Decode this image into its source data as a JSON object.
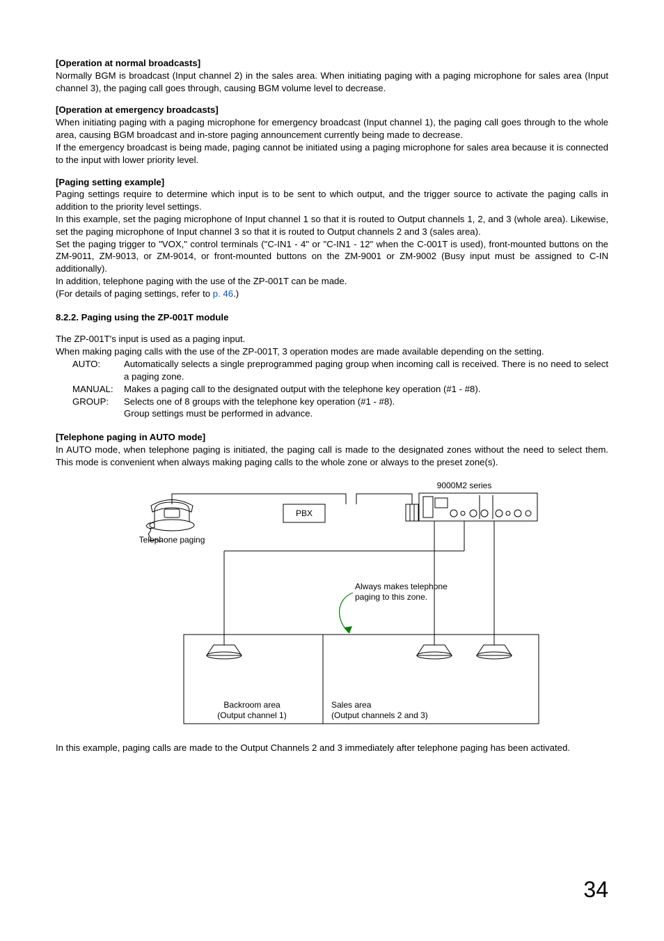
{
  "s1": {
    "heading": "[Operation at normal broadcasts]",
    "body": "Normally BGM is broadcast (Input channel 2) in the sales area. When initiating paging with a paging microphone for sales area (Input channel 3), the paging call goes through, causing BGM volume level to decrease."
  },
  "s2": {
    "heading": "[Operation at emergency broadcasts]",
    "p1": "When initiating paging with a paging microphone for emergency broadcast (Input channel 1), the paging call goes through to the whole area, causing BGM broadcast and in-store paging announcement currently being made to decrease.",
    "p2": "If the emergency broadcast is being made, paging cannot be initiated using a paging microphone for sales area because it is connected to the input with lower priority level."
  },
  "s3": {
    "heading": "[Paging setting example]",
    "p1": "Paging settings require to determine which input is to be sent to which output, and the trigger source to activate the paging calls in addition to the priority level settings.",
    "p2": "In this example, set the paging microphone of Input channel 1 so that it is routed to Output channels 1, 2, and 3 (whole area). Likewise, set the paging microphone of Input channel 3 so that it is routed to Output channels 2 and 3 (sales area).",
    "p3": "Set the paging trigger to \"VOX,\" control terminals (\"C-IN1 - 4\" or \"C-IN1 - 12\" when the C-001T is used), front-mounted buttons on the ZM-9011, ZM-9013, or ZM-9014, or front-mounted buttons on the ZM-9001 or ZM-9002 (Busy input must be assigned to C-IN additionally).",
    "p4": "In addition, telephone paging with the use of the ZP-001T can be made.",
    "p5a": "(For details of paging settings, refer to ",
    "p5_link": "p. 46",
    "p5b": ".)"
  },
  "s4": {
    "heading": "8.2.2. Paging using the ZP-001T module",
    "p1": "The ZP-001T's input is used as a paging input.",
    "p2": "When making paging calls with the use of the ZP-001T, 3 operation modes are made available depending on the setting.",
    "auto_k": "AUTO:",
    "auto_v": "Automatically selects a single preprogrammed paging group when incoming call is received. There is no need to select a paging zone.",
    "man_k": "MANUAL:",
    "man_v": "Makes a paging call to the designated output with the telephone key operation (#1 - #8).",
    "grp_k": "GROUP:",
    "grp_v": "Selects one of 8 groups with the telephone key operation (#1 - #8).",
    "grp_v2": "Group settings must be performed in advance."
  },
  "s5": {
    "heading": "[Telephone paging in AUTO mode]",
    "p1": "In AUTO mode, when telephone paging is initiated, the paging call is made to the designated zones without the need to select them. This mode is convenient when always making paging calls to the whole zone or always to the preset zone(s)."
  },
  "diagram": {
    "ampLabel": "9000M2 series",
    "pbx": "PBX",
    "telPaging": "Telephone paging",
    "arrow1": "Always makes telephone",
    "arrow2": "paging to this zone.",
    "zoneL1": "Backroom area",
    "zoneL2": "(Output channel 1)",
    "zoneR1": "Sales area",
    "zoneR2": "(Output channels 2 and 3)"
  },
  "s6": {
    "p1": "In this example, paging calls are made to the Output Channels 2 and 3 immediately after telephone paging has been activated."
  },
  "pageNumber": "34"
}
